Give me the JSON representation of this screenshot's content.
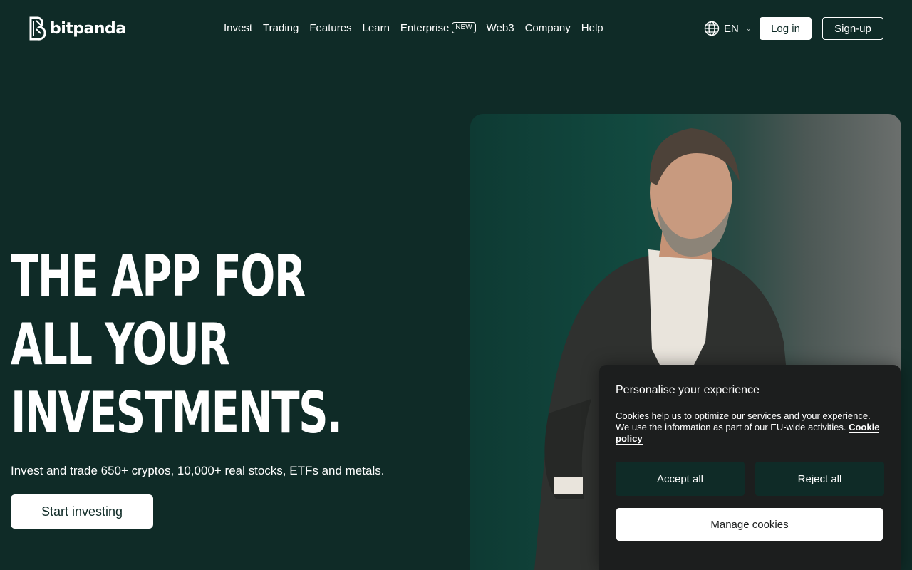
{
  "header": {
    "logo_text": "bitpanda",
    "nav": [
      {
        "label": "Invest"
      },
      {
        "label": "Trading"
      },
      {
        "label": "Features"
      },
      {
        "label": "Learn"
      },
      {
        "label": "Enterprise",
        "badge": "NEW"
      },
      {
        "label": "Web3"
      },
      {
        "label": "Company"
      },
      {
        "label": "Help"
      }
    ],
    "language": "EN",
    "login_label": "Log in",
    "signup_label": "Sign-up"
  },
  "hero": {
    "title_lines": [
      "THE APP FOR",
      "ALL YOUR",
      "INVESTMENTS."
    ],
    "subtitle": "Invest and trade 650+ cryptos, 10,000+ real stocks, ETFs and metals.",
    "cta_label": "Start investing"
  },
  "cookie_banner": {
    "title": "Personalise your experience",
    "text": "Cookies help us to optimize our services and your experience. We use the information as part of our EU-wide activities. ",
    "link_label": "Cookie policy",
    "accept_label": "Accept all",
    "reject_label": "Reject all",
    "manage_label": "Manage cookies"
  },
  "colors": {
    "background": "#0f2b27",
    "cookie_bg": "#1c1e1e",
    "button_dark": "#0f2b27",
    "white": "#ffffff"
  },
  "icons": {
    "logo": "bitpanda-logo-icon",
    "language": "globe-icon",
    "dropdown": "chevron-down-icon"
  }
}
